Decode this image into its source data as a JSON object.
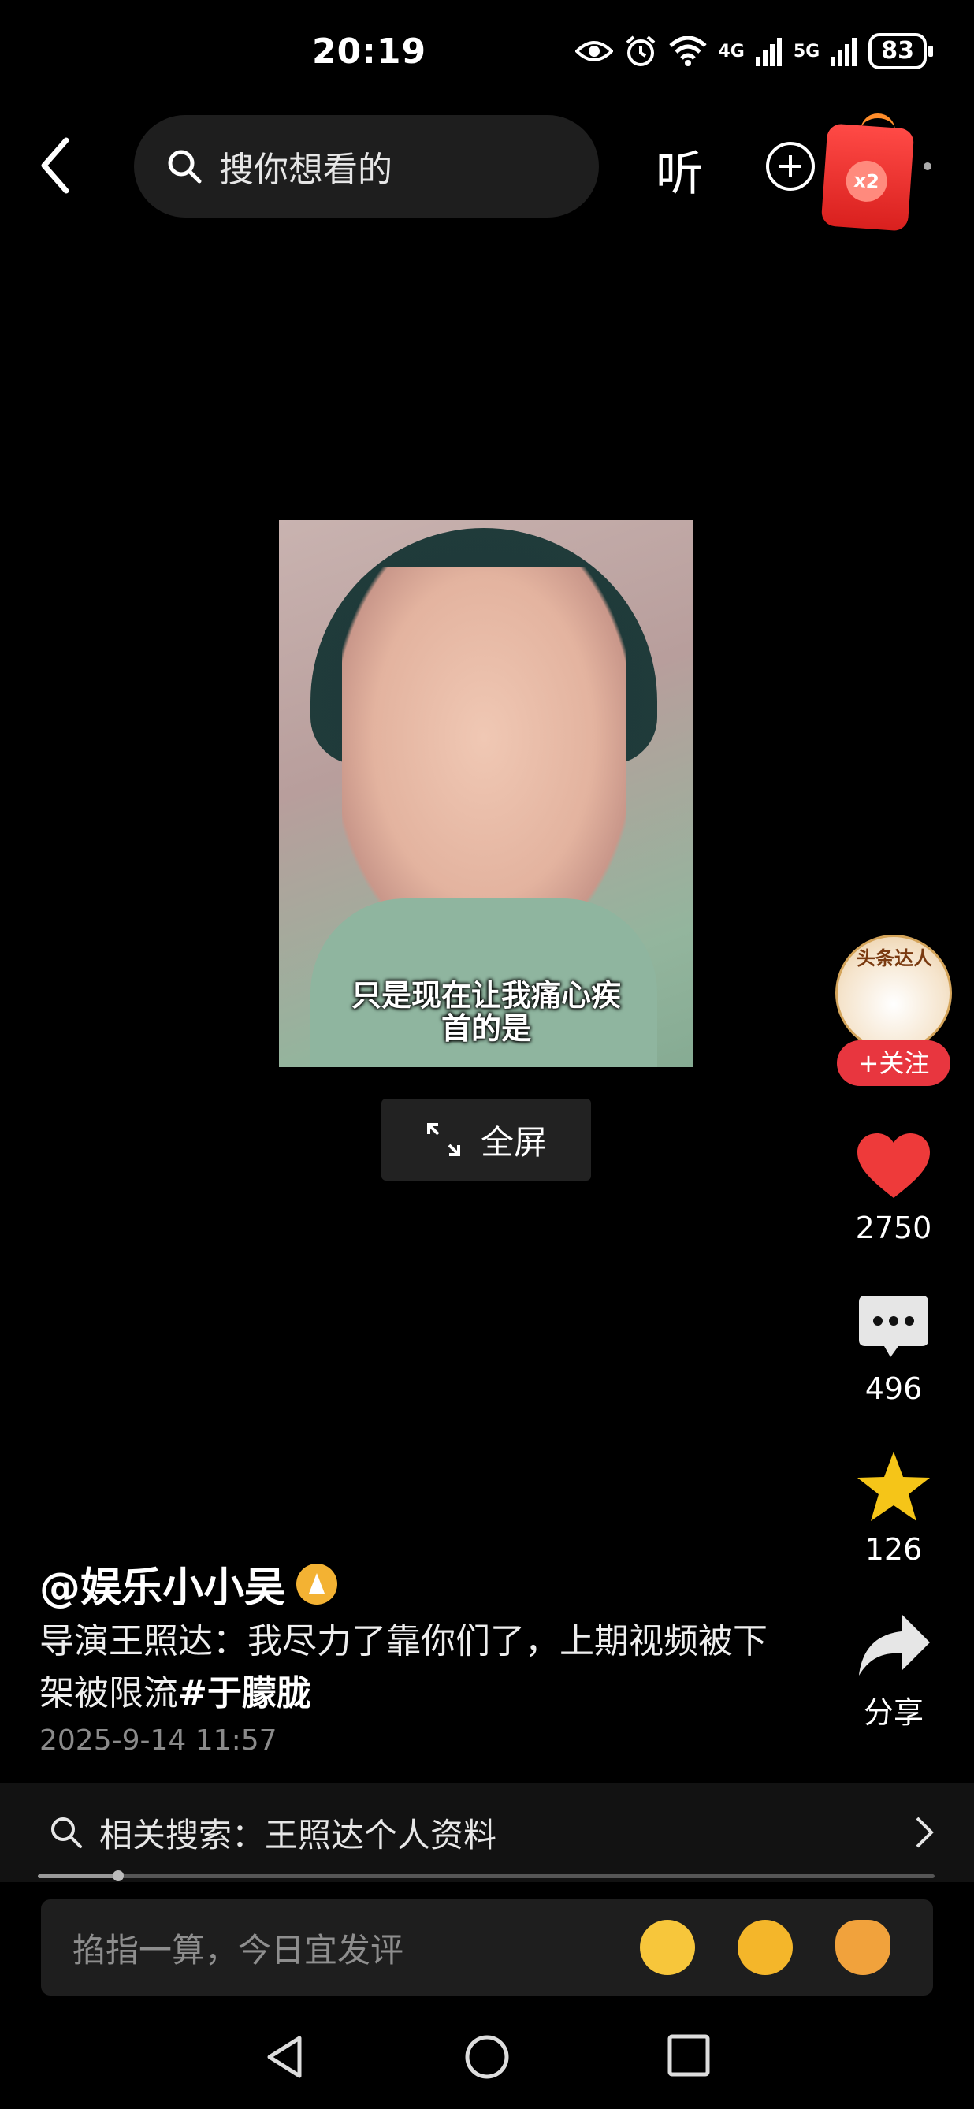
{
  "status_bar": {
    "time": "20:19",
    "net1": "4G",
    "net2": "5G",
    "battery": "83"
  },
  "top_bar": {
    "search_placeholder": "搜你想看的",
    "listen_label": "听",
    "redpack_label": "x2"
  },
  "video": {
    "subtitle_line1": "只是现在让我痛心疾",
    "subtitle_line2": "首的是",
    "fullscreen_label": "全屏"
  },
  "right_rail": {
    "avatar_text": "头条达人",
    "follow_label": "+关注",
    "likes": "2750",
    "comments": "496",
    "favorites": "126",
    "share_label": "分享"
  },
  "post": {
    "author": "@娱乐小小吴",
    "caption": "导演王照达：我尽力了靠你们了，上期视频被下架被限流",
    "hashtag": "#于朦胧",
    "date": "2025-9-14 11:57"
  },
  "related_search": {
    "label": "相关搜索：王照达个人资料"
  },
  "playback": {
    "progress_fraction": 0.09
  },
  "comment_bar": {
    "placeholder": "掐指一算，今日宜发评"
  },
  "colors": {
    "accent_red": "#e8363f",
    "like_red": "#ee3a3a",
    "star_yellow": "#f5c518",
    "background": "#000000"
  }
}
